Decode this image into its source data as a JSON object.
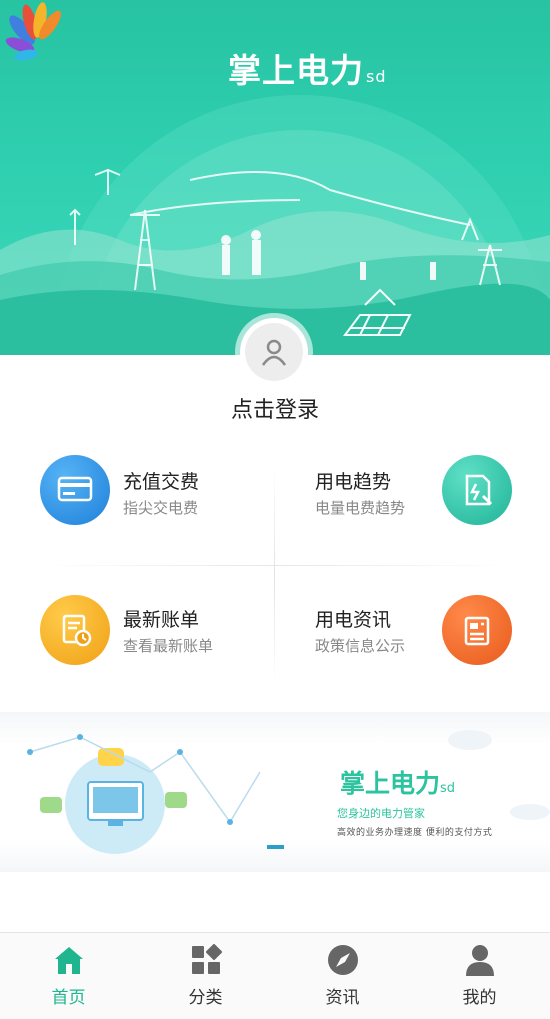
{
  "header": {
    "app_name": "掌上电力",
    "app_name_suffix": "sd"
  },
  "login": {
    "label": "点击登录"
  },
  "services": [
    {
      "title": "充值交费",
      "subtitle": "指尖交电费",
      "icon": "wallet-card-icon",
      "color": "#2a8fe6"
    },
    {
      "title": "用电趋势",
      "subtitle": "电量电费趋势",
      "icon": "document-trend-icon",
      "color": "#2cc4a8"
    },
    {
      "title": "最新账单",
      "subtitle": "查看最新账单",
      "icon": "bill-clock-icon",
      "color": "#f5a623"
    },
    {
      "title": "用电资讯",
      "subtitle": "政策信息公示",
      "icon": "news-icon",
      "color": "#f06a2a"
    }
  ],
  "banner": {
    "title": "掌上电力",
    "title_suffix": "sd",
    "slogan": "您身边的电力管家",
    "tagline": "高效的业务办理速度  便利的支付方式"
  },
  "tabs": [
    {
      "label": "首页",
      "icon": "home-icon",
      "active": true
    },
    {
      "label": "分类",
      "icon": "category-icon",
      "active": false
    },
    {
      "label": "资讯",
      "icon": "compass-icon",
      "active": false
    },
    {
      "label": "我的",
      "icon": "user-icon",
      "active": false
    }
  ],
  "colors": {
    "brand": "#2cc39f",
    "tab_active": "#20b58f"
  }
}
